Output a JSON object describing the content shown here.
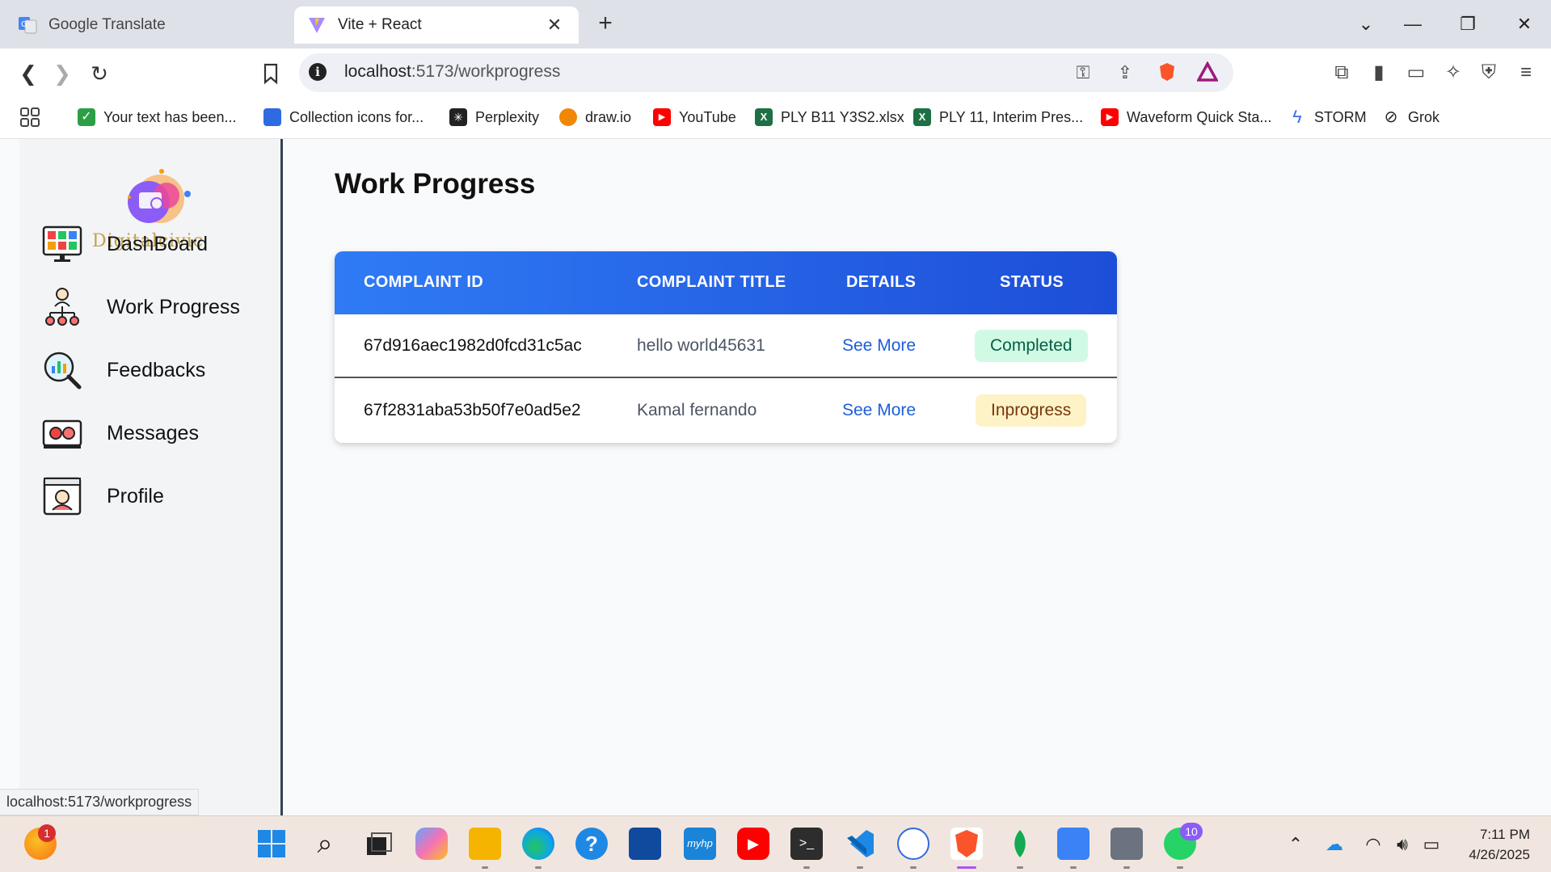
{
  "browser": {
    "tabs": [
      {
        "title": "Google Translate",
        "active": false
      },
      {
        "title": "Vite + React",
        "active": true
      }
    ],
    "url_host": "localhost",
    "url_path": ":5173/workprogress",
    "bookmarks": [
      {
        "label": "Your text has been...",
        "icon": "check-icon",
        "color": "#2e9e46"
      },
      {
        "label": "Collection icons for...",
        "icon": "doc-icon",
        "color": "#2f6be0"
      },
      {
        "label": "Perplexity",
        "icon": "perplexity-icon",
        "color": "#222222"
      },
      {
        "label": "draw.io",
        "icon": "drawio-icon",
        "color": "#f08705"
      },
      {
        "label": "YouTube",
        "icon": "youtube-icon",
        "color": "#ff0000"
      },
      {
        "label": "PLY B11 Y3S2.xlsx",
        "icon": "excel-icon",
        "color": "#1d7044"
      },
      {
        "label": "PLY 11, Interim Pres...",
        "icon": "excel-icon",
        "color": "#1d7044"
      },
      {
        "label": "Waveform Quick Sta...",
        "icon": "youtube-icon",
        "color": "#ff0000"
      },
      {
        "label": "STORM",
        "icon": "bolt-icon",
        "color": "#3b6ee8"
      },
      {
        "label": "Grok",
        "icon": "grok-icon",
        "color": "#222222"
      }
    ],
    "status_url": "localhost:5173/workprogress"
  },
  "app": {
    "logo_text": "Digitalcivic",
    "nav": [
      {
        "label": "DashBoard",
        "icon": "dashboard-icon"
      },
      {
        "label": "Work Progress",
        "icon": "hierarchy-icon"
      },
      {
        "label": "Feedbacks",
        "icon": "feedback-search-icon"
      },
      {
        "label": "Messages",
        "icon": "messages-icon"
      },
      {
        "label": "Profile",
        "icon": "profile-card-icon"
      }
    ],
    "page_title": "Work Progress",
    "table": {
      "headers": [
        "COMPLAINT ID",
        "COMPLAINT TITLE",
        "DETAILS",
        "STATUS"
      ],
      "rows": [
        {
          "id": "67d916aec1982d0fcd31c5ac",
          "title": "hello world45631",
          "details": "See More",
          "status": "Completed"
        },
        {
          "id": "67f2831aba53b50f7e0ad5e2",
          "title": "Kamal fernando",
          "details": "See More",
          "status": "Inprogress"
        }
      ]
    }
  },
  "taskbar": {
    "weather_badge": "1",
    "whatsapp_badge": "10",
    "time": "7:11 PM",
    "date": "4/26/2025"
  },
  "colors": {
    "header_start": "#2f7bf5",
    "header_end": "#1d4ed8",
    "completed_bg": "#d1fae5",
    "inprogress_bg": "#fef3c7",
    "link": "#1d5ed8"
  }
}
